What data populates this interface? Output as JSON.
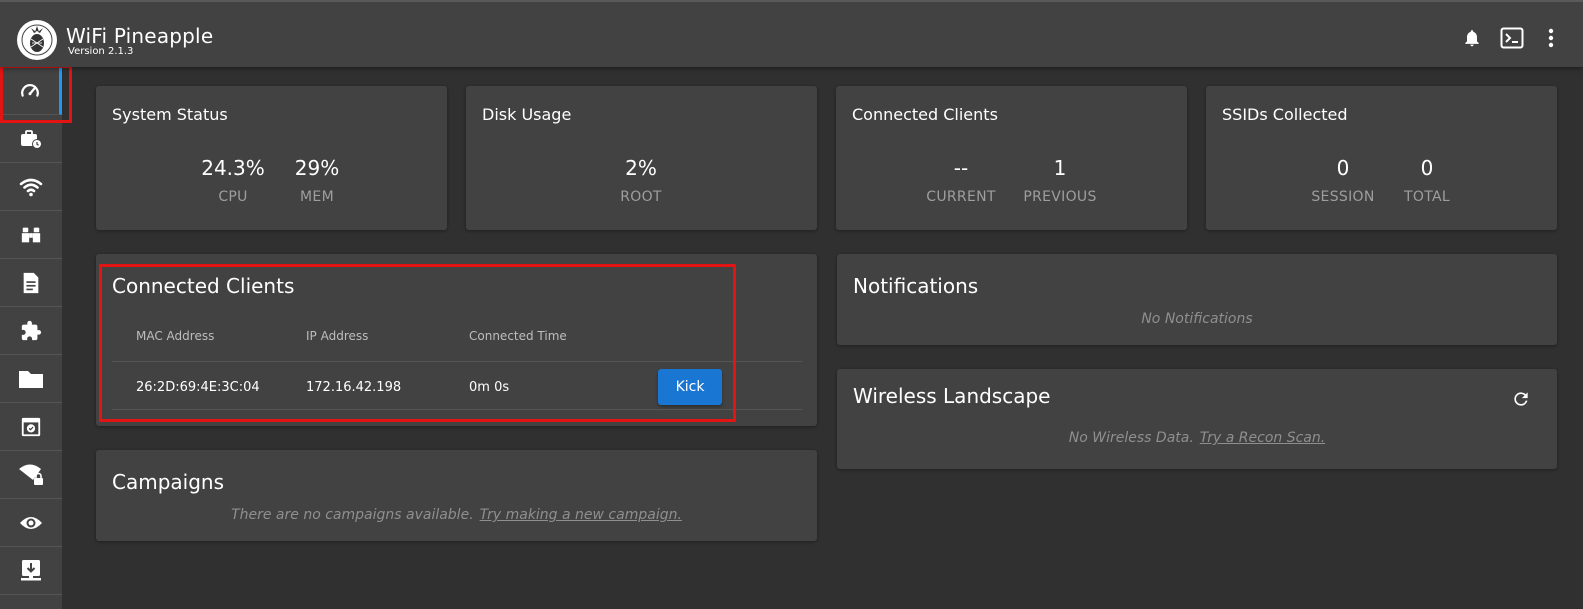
{
  "header": {
    "title": "WiFi Pineapple",
    "version": "Version 2.1.3",
    "icons": [
      "pineapple-logo",
      "bell-icon",
      "terminal-icon",
      "kebab-menu-icon"
    ]
  },
  "sidebar": {
    "items": [
      {
        "icon": "dashboard-gauge-icon",
        "active": true
      },
      {
        "icon": "briefcase-clock-icon",
        "active": false
      },
      {
        "icon": "wifi-icon",
        "active": false
      },
      {
        "icon": "binoculars-icon",
        "active": false
      },
      {
        "icon": "document-icon",
        "active": false
      },
      {
        "icon": "puzzle-icon",
        "active": false
      },
      {
        "icon": "folder-icon",
        "active": false
      },
      {
        "icon": "window-check-icon",
        "active": false
      },
      {
        "icon": "wifi-lock-icon",
        "active": false
      },
      {
        "icon": "eye-icon",
        "active": false
      },
      {
        "icon": "download-tray-icon",
        "active": false
      }
    ],
    "accent_color": "#2196f3"
  },
  "status_cards": {
    "system_status": {
      "title": "System Status",
      "stats": [
        {
          "value": "24.3%",
          "label": "CPU"
        },
        {
          "value": "29%",
          "label": "MEM"
        }
      ]
    },
    "disk_usage": {
      "title": "Disk Usage",
      "stats": [
        {
          "value": "2%",
          "label": "ROOT"
        }
      ]
    },
    "connected_clients": {
      "title": "Connected Clients",
      "stats": [
        {
          "value": "--",
          "label": "CURRENT"
        },
        {
          "value": "1",
          "label": "PREVIOUS"
        }
      ]
    },
    "ssids_collected": {
      "title": "SSIDs Collected",
      "stats": [
        {
          "value": "0",
          "label": "SESSION"
        },
        {
          "value": "0",
          "label": "TOTAL"
        }
      ]
    }
  },
  "clients_table": {
    "title": "Connected Clients",
    "columns": [
      "MAC Address",
      "IP Address",
      "Connected Time"
    ],
    "rows": [
      {
        "mac": "26:2D:69:4E:3C:04",
        "ip": "172.16.42.198",
        "time": "0m 0s",
        "action": "Kick"
      }
    ]
  },
  "campaigns": {
    "title": "Campaigns",
    "empty_text": "There are no campaigns available.",
    "link_text": "Try making a new campaign."
  },
  "notifications": {
    "title": "Notifications",
    "empty_text": "No Notifications"
  },
  "wireless_landscape": {
    "title": "Wireless Landscape",
    "empty_text": "No Wireless Data.",
    "link_text": "Try a Recon Scan."
  },
  "colors": {
    "background": "#303030",
    "card": "#424242",
    "primary_button": "#1976d2",
    "highlight": "#e31414"
  }
}
